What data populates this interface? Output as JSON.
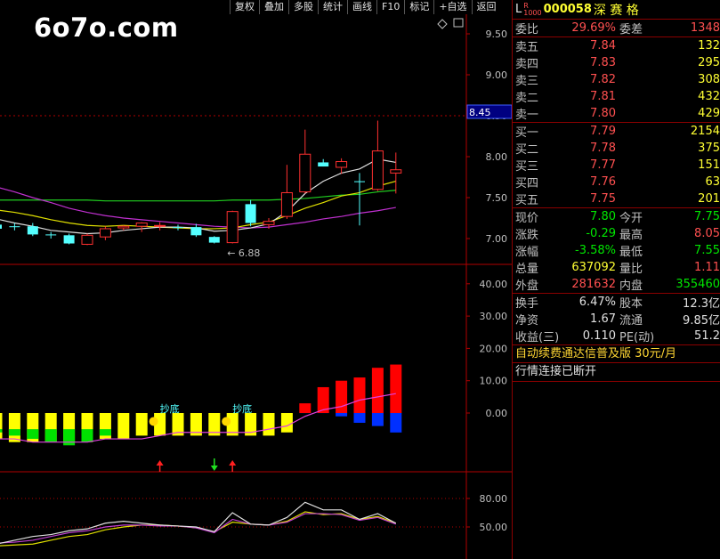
{
  "toolbar": [
    "复权",
    "叠加",
    "多股",
    "统计",
    "画线",
    "F10",
    "标记",
    "+自选",
    "返回"
  ],
  "watermark": "6o7o.com",
  "main_chart": {
    "y_ticks": [
      "9.50",
      "9.00",
      "8.50",
      "8.00",
      "7.50",
      "7.00"
    ],
    "y_values": [
      9.5,
      9.0,
      8.5,
      8.0,
      7.5,
      7.0
    ],
    "price_tag": "8.45",
    "low_marker": "← 6.88",
    "candles": [
      {
        "o": 7.17,
        "h": 7.2,
        "l": 7.12,
        "c": 7.12
      },
      {
        "o": 7.15,
        "h": 7.19,
        "l": 7.1,
        "c": 7.14
      },
      {
        "o": 7.15,
        "h": 7.19,
        "l": 7.03,
        "c": 7.05
      },
      {
        "o": 7.05,
        "h": 7.08,
        "l": 7.0,
        "c": 7.04
      },
      {
        "o": 7.04,
        "h": 7.06,
        "l": 6.93,
        "c": 6.94
      },
      {
        "o": 6.93,
        "h": 7.06,
        "l": 6.92,
        "c": 7.04
      },
      {
        "o": 7.02,
        "h": 7.15,
        "l": 6.98,
        "c": 7.12
      },
      {
        "o": 7.13,
        "h": 7.16,
        "l": 7.1,
        "c": 7.15
      },
      {
        "o": 7.15,
        "h": 7.2,
        "l": 7.08,
        "c": 7.19
      },
      {
        "o": 7.16,
        "h": 7.2,
        "l": 7.1,
        "c": 7.16
      },
      {
        "o": 7.14,
        "h": 7.17,
        "l": 7.1,
        "c": 7.13
      },
      {
        "o": 7.14,
        "h": 7.18,
        "l": 7.02,
        "c": 7.04
      },
      {
        "o": 7.02,
        "h": 7.03,
        "l": 6.94,
        "c": 6.95
      },
      {
        "o": 6.95,
        "h": 7.34,
        "l": 6.94,
        "c": 7.33
      },
      {
        "o": 7.42,
        "h": 7.47,
        "l": 7.15,
        "c": 7.19
      },
      {
        "o": 7.17,
        "h": 7.25,
        "l": 7.12,
        "c": 7.21
      },
      {
        "o": 7.27,
        "h": 7.9,
        "l": 7.24,
        "c": 7.56
      },
      {
        "o": 7.57,
        "h": 8.33,
        "l": 7.55,
        "c": 8.03
      },
      {
        "o": 7.93,
        "h": 7.97,
        "l": 7.88,
        "c": 7.88
      },
      {
        "o": 7.87,
        "h": 7.98,
        "l": 7.79,
        "c": 7.94
      },
      {
        "o": 7.7,
        "h": 7.8,
        "l": 7.16,
        "c": 7.69
      },
      {
        "o": 7.6,
        "h": 8.44,
        "l": 7.58,
        "c": 8.07
      },
      {
        "o": 7.8,
        "h": 8.05,
        "l": 7.55,
        "c": 7.84
      }
    ],
    "ma_green": [
      7.47,
      7.47,
      7.47,
      7.47,
      7.47,
      7.47,
      7.46,
      7.46,
      7.46,
      7.46,
      7.46,
      7.46,
      7.46,
      7.47,
      7.47,
      7.47,
      7.48,
      7.49,
      7.51,
      7.53,
      7.54,
      7.57,
      7.59
    ],
    "ma_purple": [
      7.63,
      7.57,
      7.5,
      7.44,
      7.37,
      7.32,
      7.28,
      7.25,
      7.23,
      7.21,
      7.19,
      7.17,
      7.15,
      7.14,
      7.13,
      7.14,
      7.17,
      7.2,
      7.24,
      7.27,
      7.31,
      7.34,
      7.38
    ],
    "ma_yellow": [
      7.35,
      7.32,
      7.28,
      7.23,
      7.19,
      7.16,
      7.15,
      7.16,
      7.15,
      7.14,
      7.13,
      7.12,
      7.12,
      7.13,
      7.17,
      7.2,
      7.28,
      7.37,
      7.44,
      7.52,
      7.56,
      7.64,
      7.7
    ],
    "ma_white": [
      7.24,
      7.19,
      7.15,
      7.1,
      7.08,
      7.06,
      7.07,
      7.1,
      7.12,
      7.14,
      7.14,
      7.13,
      7.09,
      7.1,
      7.13,
      7.18,
      7.33,
      7.55,
      7.7,
      7.8,
      7.85,
      7.97,
      7.93
    ]
  },
  "mid_chart": {
    "y_ticks": [
      "40.00",
      "30.00",
      "20.00",
      "10.00",
      "0.00"
    ],
    "y_values": [
      40,
      30,
      20,
      10,
      0
    ],
    "bars": [
      -8,
      -9,
      -9,
      -9,
      -9,
      -9,
      -8,
      -8,
      -7,
      -7,
      -7,
      -7,
      -7,
      -7,
      -7,
      -7,
      -6,
      3,
      8,
      10,
      11,
      14,
      15
    ],
    "inner": [
      -6,
      -7,
      -8,
      -9,
      -10,
      -9,
      -7,
      -5,
      -3,
      -3,
      -3,
      -3,
      -2,
      -1,
      -2,
      -3,
      -3,
      -1,
      0,
      1,
      3,
      4,
      6
    ],
    "labels": [
      {
        "i": 9,
        "text": "抄底"
      },
      {
        "i": 13,
        "text": "抄底"
      }
    ],
    "arrows": [
      {
        "i": 9,
        "dir": "up"
      },
      {
        "i": 12,
        "dir": "down"
      },
      {
        "i": 13,
        "dir": "up"
      }
    ]
  },
  "bot_chart": {
    "y_ticks": [
      "80.00",
      "50.00"
    ],
    "y_values": [
      80,
      50
    ],
    "line_white": [
      32,
      36,
      40,
      42,
      46,
      48,
      54,
      56,
      54,
      52,
      51,
      50,
      45,
      65,
      53,
      52,
      60,
      76,
      68,
      68,
      58,
      64,
      54
    ],
    "line_purple": [
      33,
      34,
      36,
      40,
      44,
      46,
      50,
      52,
      52,
      51,
      51,
      49,
      44,
      58,
      53,
      52,
      55,
      64,
      64,
      63,
      57,
      60,
      53
    ],
    "line_yellow": [
      30,
      31,
      32,
      36,
      40,
      42,
      47,
      50,
      52,
      52,
      51,
      49,
      45,
      55,
      53,
      52,
      56,
      66,
      63,
      64,
      58,
      61,
      54
    ]
  },
  "stock": {
    "prefix": "L",
    "code": "000058",
    "name": "深 赛 格",
    "ratio_label": "委比",
    "ratio_value": "29.69%",
    "diff_label": "委差",
    "diff_value": "1348",
    "asks": [
      {
        "label": "卖五",
        "price": "7.84",
        "vol": "132"
      },
      {
        "label": "卖四",
        "price": "7.83",
        "vol": "295"
      },
      {
        "label": "卖三",
        "price": "7.82",
        "vol": "308"
      },
      {
        "label": "卖二",
        "price": "7.81",
        "vol": "432"
      },
      {
        "label": "卖一",
        "price": "7.80",
        "vol": "429"
      }
    ],
    "bids": [
      {
        "label": "买一",
        "price": "7.79",
        "vol": "2154"
      },
      {
        "label": "买二",
        "price": "7.78",
        "vol": "375"
      },
      {
        "label": "买三",
        "price": "7.77",
        "vol": "151"
      },
      {
        "label": "买四",
        "price": "7.76",
        "vol": "63"
      },
      {
        "label": "买五",
        "price": "7.75",
        "vol": "201"
      }
    ],
    "quote": [
      {
        "l1": "现价",
        "v1": "7.80",
        "c1": "green",
        "l2": "今开",
        "v2": "7.75",
        "c2": "green"
      },
      {
        "l1": "涨跌",
        "v1": "-0.29",
        "c1": "green",
        "l2": "最高",
        "v2": "8.05",
        "c2": "red"
      },
      {
        "l1": "涨幅",
        "v1": "-3.58%",
        "c1": "green",
        "l2": "最低",
        "v2": "7.55",
        "c2": "green"
      },
      {
        "l1": "总量",
        "v1": "637092",
        "c1": "yellow",
        "l2": "量比",
        "v2": "1.11",
        "c2": "red"
      },
      {
        "l1": "外盘",
        "v1": "281632",
        "c1": "red",
        "l2": "内盘",
        "v2": "355460",
        "c2": "green"
      }
    ],
    "fund": [
      {
        "l1": "换手",
        "v1": "6.47%",
        "l2": "股本",
        "v2": "12.3亿"
      },
      {
        "l1": "净资",
        "v1": "1.67",
        "l2": "流通",
        "v2": "9.85亿"
      },
      {
        "l1": "收益(三)",
        "v1": "0.110",
        "l2": "PE(动)",
        "v2": "51.2"
      }
    ],
    "ad": "自动续费通达信普及版  30元/月",
    "status": "行情连接已断开"
  },
  "colors": {
    "up": "#ff3030",
    "down": "#54ffff",
    "axis_red": "#b00000",
    "bar_yellow": "#ffff00",
    "bar_green": "#00e000",
    "bar_red": "#ff0000",
    "bar_blue": "#0030ff"
  }
}
